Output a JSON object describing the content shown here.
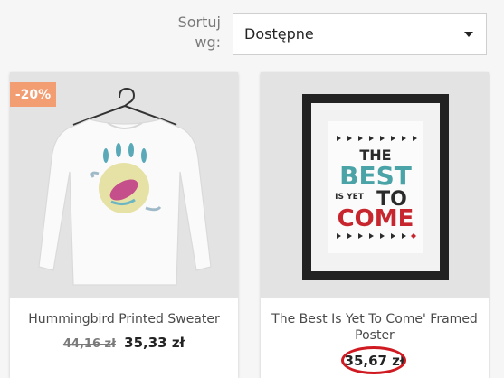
{
  "sort": {
    "label": "Sortuj wg:",
    "selected": "Dostępne"
  },
  "products": [
    {
      "title": "Hummingbird Printed Sweater",
      "badge": "-20%",
      "old_price": "44,16 zł",
      "price": "35,33 zł"
    },
    {
      "title": "The Best Is Yet To Come' Framed Poster",
      "price": "35,67 zł",
      "poster_text": {
        "line1": "THE",
        "line2": "BEST",
        "line3a": "IS YET",
        "line3b": "TO",
        "line4": "COME"
      }
    }
  ],
  "colors": {
    "badge": "#f39d72",
    "annotation_circle": "#d01a22",
    "poster_teal": "#4aa3a6",
    "poster_red": "#c8262f",
    "poster_dark": "#2b2b2b"
  }
}
